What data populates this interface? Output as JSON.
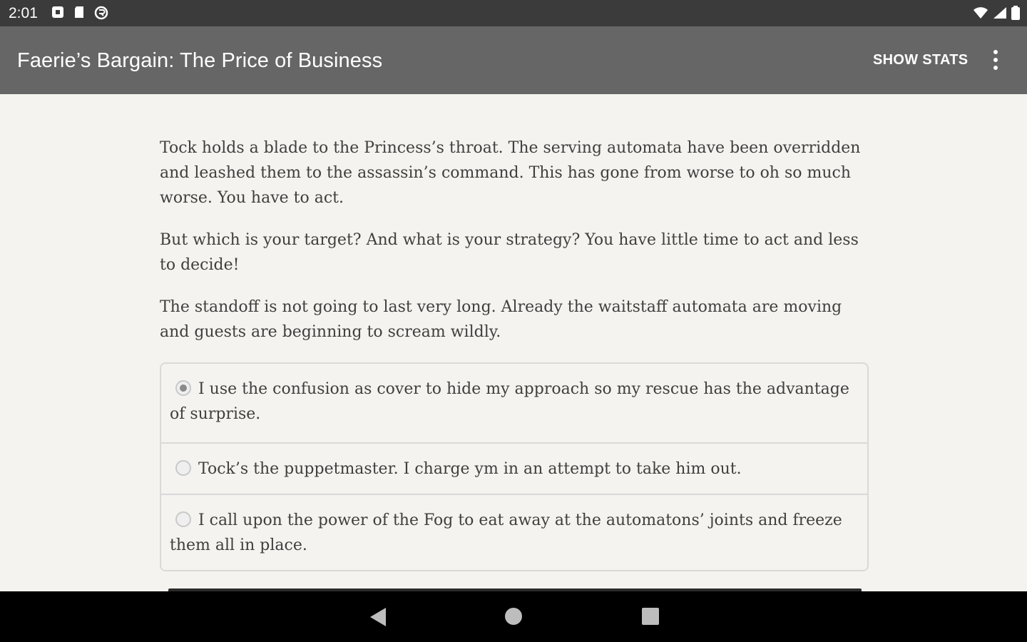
{
  "status_bar": {
    "time": "2:01",
    "left_icons": [
      "notification-icon",
      "sd-card-icon",
      "sync-icon"
    ],
    "right_icons": [
      "wifi-icon",
      "cell-signal-icon",
      "battery-icon"
    ]
  },
  "app_bar": {
    "title": "Faerie’s Bargain: The Price of Business",
    "show_stats_label": "SHOW STATS",
    "overflow_icon": "more-vert-icon"
  },
  "story": {
    "paragraphs": [
      "Tock holds a blade to the Princess’s throat. The serving automata have been overridden and leashed them to the assassin’s command. This has gone from worse to oh so much worse. You have to act.",
      "But which is your target? And what is your strategy? You have little time to act and less to decide!",
      "The standoff is not going to last very long. Already the waitstaff automata are moving and guests are beginning to scream wildly."
    ]
  },
  "choices": [
    {
      "label": "I use the confusion as cover to hide my approach so my rescue has the advantage of surprise.",
      "selected": true
    },
    {
      "label": "Tock’s the puppetmaster. I charge ym in an attempt to take him out.",
      "selected": false
    },
    {
      "label": "I call upon the power of the Fog to eat away at the automatons’ joints and freeze them all in place.",
      "selected": false
    }
  ],
  "nav_bar": {
    "icons": [
      "back-icon",
      "home-icon",
      "recents-icon"
    ]
  },
  "colors": {
    "status_bar": "#3b3b3b",
    "app_bar": "#666666",
    "background": "#f5f3ef",
    "text": "#3f3f3f",
    "nav_bar": "#000000"
  }
}
